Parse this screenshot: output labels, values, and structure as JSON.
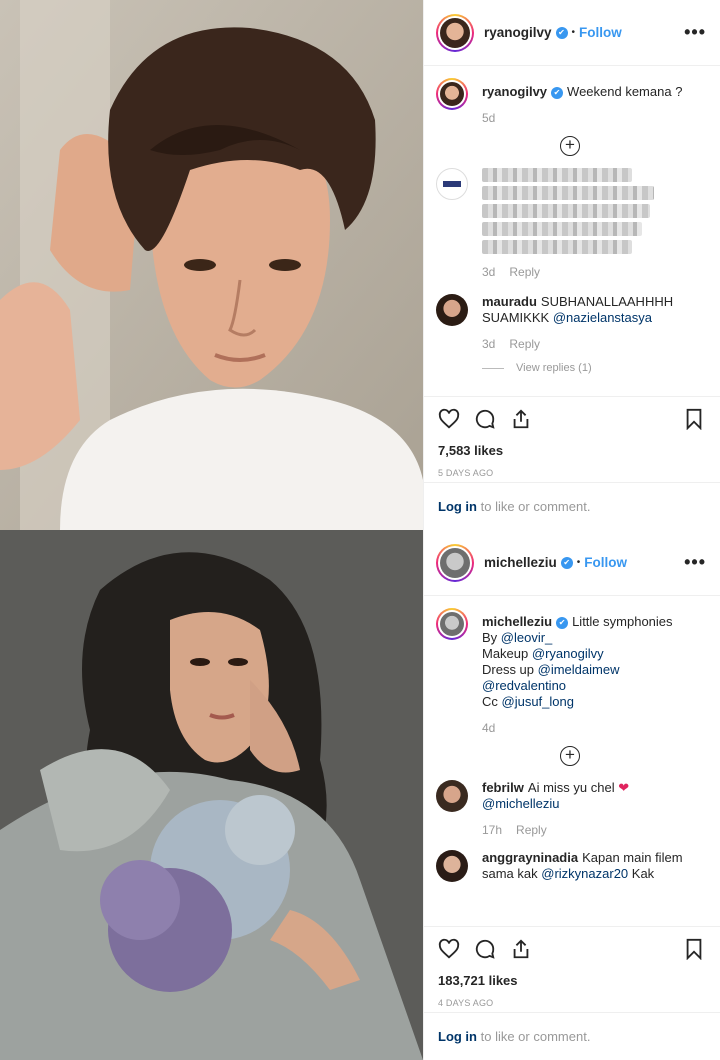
{
  "posts": [
    {
      "username": "ryanogilvy",
      "follow_label": "Follow",
      "dot": "•",
      "more": "•••",
      "caption": {
        "username": "ryanogilvy",
        "text": "Weekend kemana ?",
        "age": "5d"
      },
      "load_more": "+",
      "comments": [
        {
          "username": "",
          "blurred": true,
          "age": "3d",
          "reply": "Reply"
        },
        {
          "username": "mauradu",
          "text": "SUBHANALLAAHHHH SUAMIKKK",
          "mention": "@nazielanstasya",
          "age": "3d",
          "reply": "Reply",
          "view_replies": "View replies (1)"
        }
      ],
      "likes": "7,583 likes",
      "date": "5 DAYS AGO",
      "login_link": "Log in",
      "login_rest": " to like or comment."
    },
    {
      "username": "michelleziu",
      "follow_label": "Follow",
      "dot": "•",
      "more": "•••",
      "caption": {
        "username": "michelleziu",
        "text": "Little symphonies",
        "lines": [
          {
            "prefix": "By ",
            "mention": "@leovir_"
          },
          {
            "prefix": "Makeup ",
            "mention": "@ryanogilvy"
          },
          {
            "prefix": "Dress up ",
            "mention": "@imeldaimew"
          },
          {
            "prefix": "",
            "mention": "@redvalentino"
          },
          {
            "prefix": "Cc ",
            "mention": "@jusuf_long"
          }
        ],
        "age": "4d"
      },
      "load_more": "+",
      "comments": [
        {
          "username": "febrilw",
          "text": "Ai miss yu chel",
          "emoji": "❤",
          "mention": "@michelleziu",
          "age": "17h",
          "reply": "Reply"
        },
        {
          "username": "anggrayninadia",
          "text": "Kapan main filem sama kak",
          "mention": "@rizkynazar20",
          "suffix": " Kak"
        }
      ],
      "likes": "183,721 likes",
      "date": "4 DAYS AGO",
      "login_link": "Log in",
      "login_rest": " to like or comment."
    }
  ],
  "colors": {
    "accent": "#3897f0",
    "mention": "#003569",
    "muted": "#999999"
  },
  "icons": [
    "heart-icon",
    "comment-icon",
    "share-icon",
    "bookmark-icon",
    "verified-badge-icon",
    "more-options-icon",
    "add-comment-icon"
  ]
}
